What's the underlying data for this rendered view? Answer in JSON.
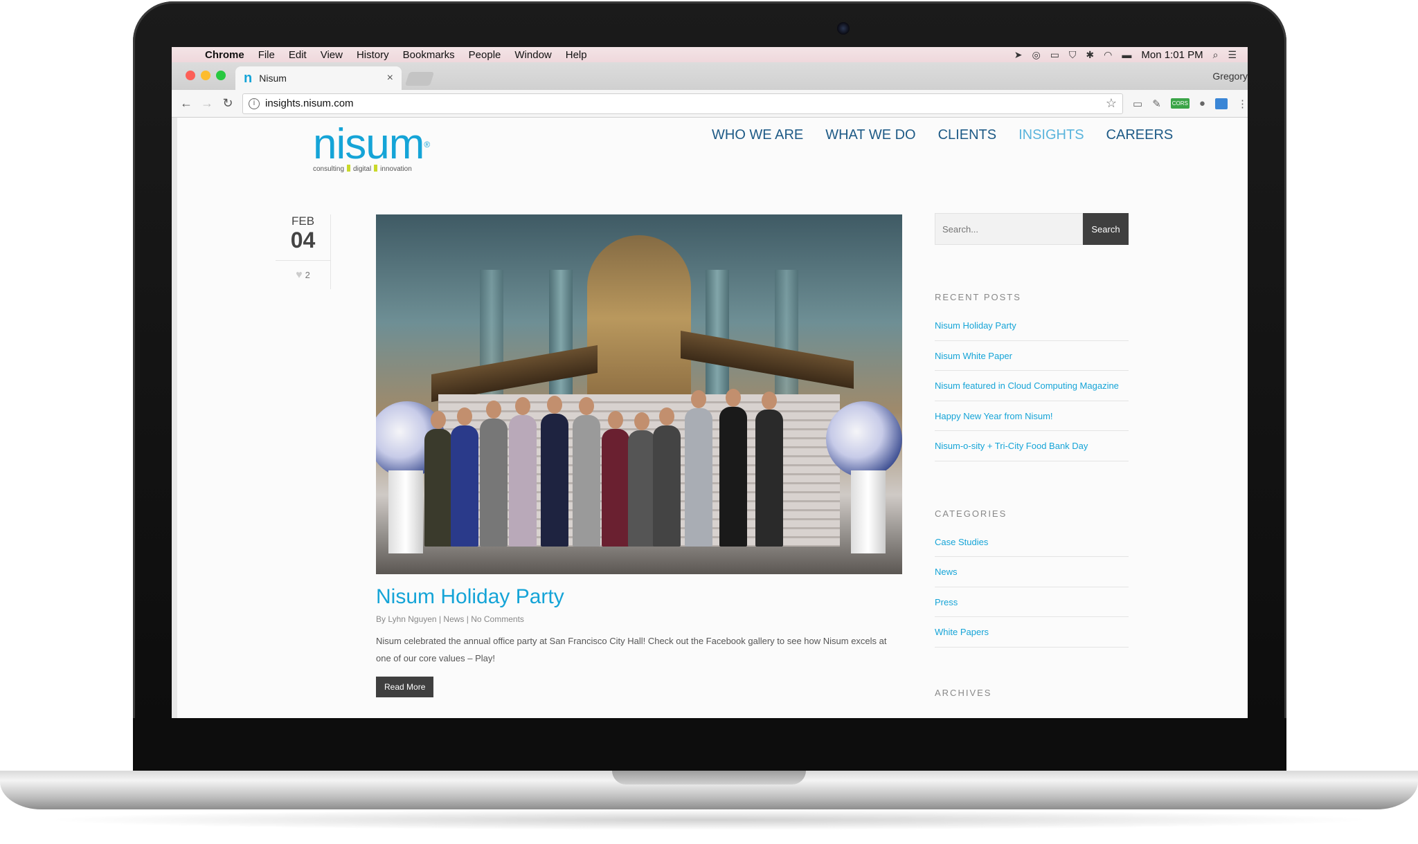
{
  "menubar": {
    "items": [
      "Chrome",
      "File",
      "Edit",
      "View",
      "History",
      "Bookmarks",
      "People",
      "Window",
      "Help"
    ],
    "clock": "Mon 1:01 PM"
  },
  "browser": {
    "tab_title": "Nisum",
    "tab_favicon": "n",
    "profile_name": "Gregory",
    "url": "insights.nisum.com",
    "extension_badge": "CORS"
  },
  "site": {
    "logo_word": "nisum",
    "logo_reg": "®",
    "logo_tag": [
      "consulting",
      "digital",
      "innovation"
    ],
    "nav": [
      "WHO WE ARE",
      "WHAT WE DO",
      "CLIENTS",
      "INSIGHTS",
      "CAREERS"
    ],
    "active_nav": "INSIGHTS",
    "brand_color": "#15a4d7"
  },
  "post": {
    "month": "FEB",
    "day": "04",
    "likes": "2",
    "title": "Nisum Holiday Party",
    "author": "By Lyhn Nguyen",
    "category": "News",
    "comments": "No Comments",
    "excerpt": "Nisum celebrated the annual office party at San Francisco City Hall! Check out the Facebook gallery to see how Nisum excels at one of our core values – Play!",
    "read_more": "Read More"
  },
  "sidebar": {
    "search_placeholder": "Search...",
    "search_button": "Search",
    "recent_posts_title": "RECENT POSTS",
    "recent_posts": [
      "Nisum Holiday Party",
      "Nisum White Paper",
      "Nisum featured in Cloud Computing Magazine",
      "Happy New Year from Nisum!",
      "Nisum-o-sity + Tri-City Food Bank Day"
    ],
    "categories_title": "CATEGORIES",
    "categories": [
      "Case Studies",
      "News",
      "Press",
      "White Papers"
    ],
    "archives_title": "ARCHIVES"
  }
}
